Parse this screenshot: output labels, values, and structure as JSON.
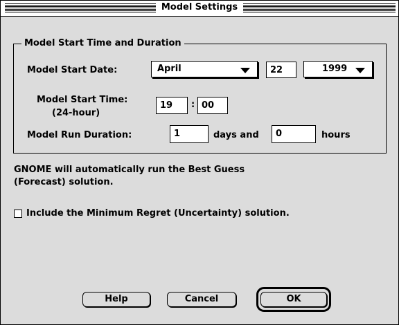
{
  "window": {
    "title": "Model Settings"
  },
  "group": {
    "label": "Model Start Time and Duration"
  },
  "start_date": {
    "label": "Model Start Date:",
    "month": "April",
    "day": "22",
    "year": "1999"
  },
  "start_time": {
    "label_line1": "Model Start Time:",
    "label_line2": "(24-hour)",
    "hour": "19",
    "separator": ":",
    "minute": "00"
  },
  "duration": {
    "label": "Model Run Duration:",
    "days": "1",
    "days_label": "days and",
    "hours": "0",
    "hours_label": "hours"
  },
  "info": {
    "line1": "GNOME will automatically run the Best Guess",
    "line2": "(Forecast) solution."
  },
  "uncertainty": {
    "label": "Include the Minimum Regret (Uncertainty) solution.",
    "checked": false
  },
  "buttons": {
    "help": "Help",
    "cancel": "Cancel",
    "ok": "OK"
  }
}
